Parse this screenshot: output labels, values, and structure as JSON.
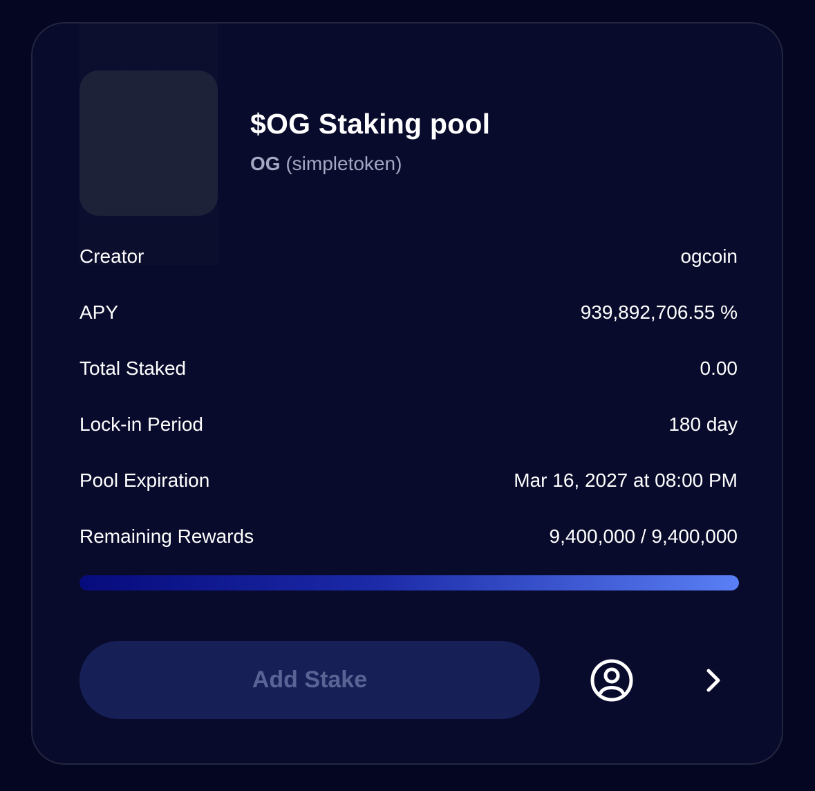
{
  "pool": {
    "title": "$OG Staking pool",
    "token_symbol": "OG",
    "token_name": "(simpletoken)"
  },
  "details": [
    {
      "label": "Creator",
      "value": "ogcoin"
    },
    {
      "label": "APY",
      "value": "939,892,706.55 %"
    },
    {
      "label": "Total Staked",
      "value": "0.00"
    },
    {
      "label": "Lock-in Period",
      "value": "180 day"
    },
    {
      "label": "Pool Expiration",
      "value": "Mar 16, 2027 at 08:00 PM"
    },
    {
      "label": "Remaining Rewards",
      "value": "9,400,000 / 9,400,000"
    }
  ],
  "rewards_progress_fraction": 1.0,
  "actions": {
    "add_stake_label": "Add Stake",
    "user_icon": "user-circle-icon",
    "next_icon": "chevron-right-icon"
  },
  "colors": {
    "background": "#050622",
    "card": "#090b2c",
    "progress_start": "#060b7c",
    "progress_end": "#5a7ff5",
    "button": "#162057",
    "button_text": "#5a6394"
  }
}
